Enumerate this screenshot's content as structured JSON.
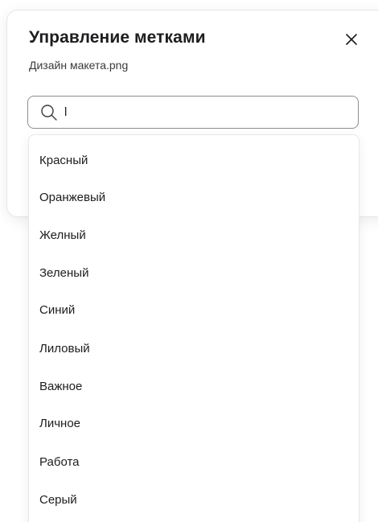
{
  "dialog": {
    "title": "Управление метками",
    "subtitle": "Дизайн макета.png",
    "close_icon": "close-icon"
  },
  "search": {
    "value": "l",
    "icon": "search-icon"
  },
  "dropdown": {
    "options": [
      "Красный",
      "Оранжевый",
      "Желный",
      "Зеленый",
      "Синий",
      "Лиловый",
      "Важное",
      "Личное",
      "Работа",
      "Серый"
    ]
  }
}
